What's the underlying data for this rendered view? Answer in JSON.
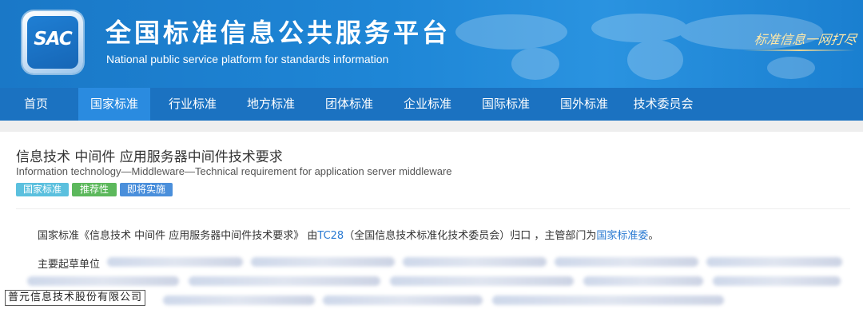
{
  "header": {
    "logo_text": "SAC",
    "title": "全国标准信息公共服务平台",
    "subtitle": "National public service platform  for standards information",
    "slogan": "标准信息一网打尽"
  },
  "nav": {
    "items": [
      {
        "label": "首页"
      },
      {
        "label": "国家标准"
      },
      {
        "label": "行业标准"
      },
      {
        "label": "地方标准"
      },
      {
        "label": "团体标准"
      },
      {
        "label": "企业标准"
      },
      {
        "label": "国际标准"
      },
      {
        "label": "国外标准"
      },
      {
        "label": "技术委员会"
      }
    ],
    "active": "国家标准"
  },
  "standard": {
    "title_cn": "信息技术 中间件 应用服务器中间件技术要求",
    "title_en": "Information technology—Middleware—Technical requirement for application server middleware",
    "tags": [
      {
        "label": "国家标准",
        "color": "#5bc0de"
      },
      {
        "label": "推荐性",
        "color": "#5cb85c"
      },
      {
        "label": "即将实施",
        "color": "#4a8fdb"
      }
    ],
    "desc_prefix": "国家标准《信息技术 中间件 应用服务器中间件技术要求》 由",
    "tc_link": "TC28",
    "desc_mid": "（全国信息技术标准化技术委员会）归口 ，主管部门为",
    "authority_link": "国家标准委",
    "desc_suffix": "。",
    "drafters_label": "主要起草单位"
  },
  "watermark": {
    "company": "普元信息技术股份有限公司"
  },
  "colors": {
    "banner": "#1e86d6",
    "nav": "#1b72c1",
    "nav_active": "#2a8be0",
    "link": "#2a7ad2"
  }
}
